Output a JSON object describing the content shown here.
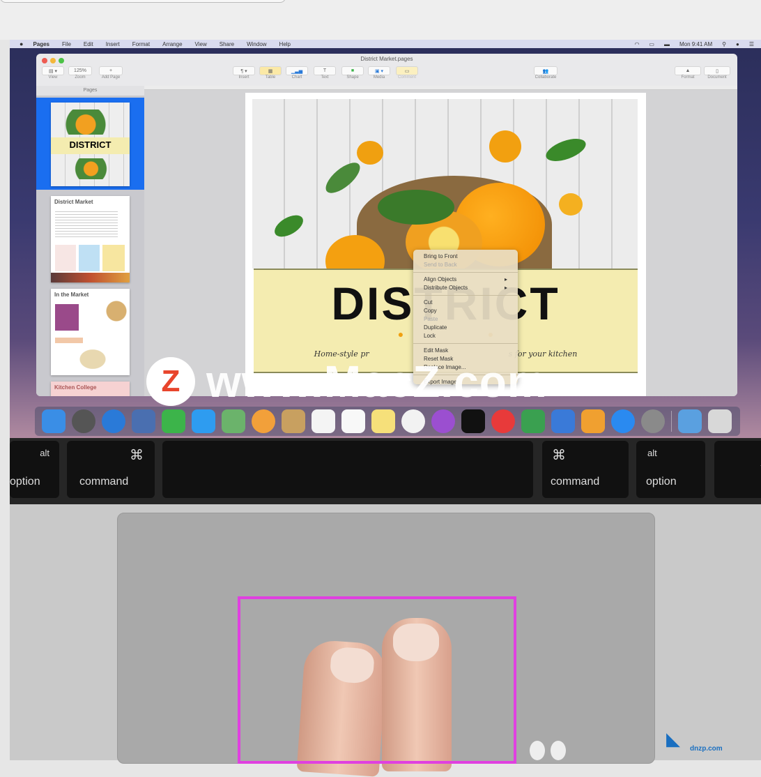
{
  "menubar": {
    "items": [
      "Pages",
      "File",
      "Edit",
      "Insert",
      "Format",
      "Arrange",
      "View",
      "Share",
      "Window",
      "Help"
    ],
    "clock": "Mon 9:41 AM"
  },
  "window": {
    "title": "District Market.pages",
    "toolbar": {
      "view": "View",
      "zoom": "Zoom",
      "zoom_value": "125%",
      "add_page": "Add Page",
      "insert": "Insert",
      "table": "Table",
      "chart": "Chart",
      "text": "Text",
      "shape": "Shape",
      "media": "Media",
      "comment": "Comment",
      "collaborate": "Collaborate",
      "format": "Format",
      "document": "Document"
    },
    "sidebar": {
      "header": "Pages",
      "thumbs": [
        "DISTRICT",
        "District Market",
        "In the Market",
        "Kitchen College"
      ]
    }
  },
  "document": {
    "title": "DISTRICT",
    "subtitle_left": "Home-style pr",
    "subtitle_right": "s for your kitchen"
  },
  "context_menu": {
    "items": [
      {
        "label": "Bring to Front"
      },
      {
        "label": "Send to Back",
        "disabled": true
      },
      {
        "sep": true
      },
      {
        "label": "Align Objects",
        "submenu": true
      },
      {
        "label": "Distribute Objects",
        "submenu": true
      },
      {
        "sep": true
      },
      {
        "label": "Cut"
      },
      {
        "label": "Copy"
      },
      {
        "label": "Paste",
        "disabled": true
      },
      {
        "label": "Duplicate"
      },
      {
        "label": "Lock"
      },
      {
        "sep": true
      },
      {
        "label": "Edit Mask"
      },
      {
        "label": "Reset Mask"
      },
      {
        "label": "Replace Image..."
      },
      {
        "sep": true
      },
      {
        "label": "Export Image"
      }
    ]
  },
  "dock": {
    "apps": [
      "finder",
      "launchpad",
      "safari",
      "preview",
      "facetime",
      "messages",
      "maps",
      "photos",
      "contacts",
      "calendar",
      "reminders",
      "notes",
      "music",
      "podcasts",
      "tv",
      "news",
      "numbers",
      "keynote",
      "pages",
      "app-store",
      "system-preferences",
      "downloads",
      "trash"
    ],
    "colors": [
      "#3a8ee6",
      "#555",
      "#2a7ad8",
      "#4a6fb0",
      "#3cb44a",
      "#2e9cf0",
      "#6bb36b",
      "#f2a03a",
      "#c8a060",
      "#f4f4f4",
      "#f8f8f8",
      "#f6e07a",
      "#f2f2f2",
      "#9b4fd0",
      "#111",
      "#e83a3a",
      "#3aa050",
      "#3a7ad8",
      "#f0a030",
      "#2a8af0",
      "#8a8a8a",
      "#5aa0e0",
      "#d8d8d8"
    ]
  },
  "keyboard": {
    "left_option_mod": "alt",
    "left_option": "option",
    "left_command_symbol": "⌘",
    "left_command": "command",
    "right_command_symbol": "⌘",
    "right_command": "command",
    "right_option_mod": "alt",
    "right_option": "option",
    "arrow": "◀"
  },
  "watermark": {
    "logo": "Z",
    "text": "www.MacZ.com"
  },
  "brand": {
    "text": "dnzp.com"
  },
  "colors": {
    "highlight": "#e040e0",
    "selection": "#1a6ef0"
  }
}
